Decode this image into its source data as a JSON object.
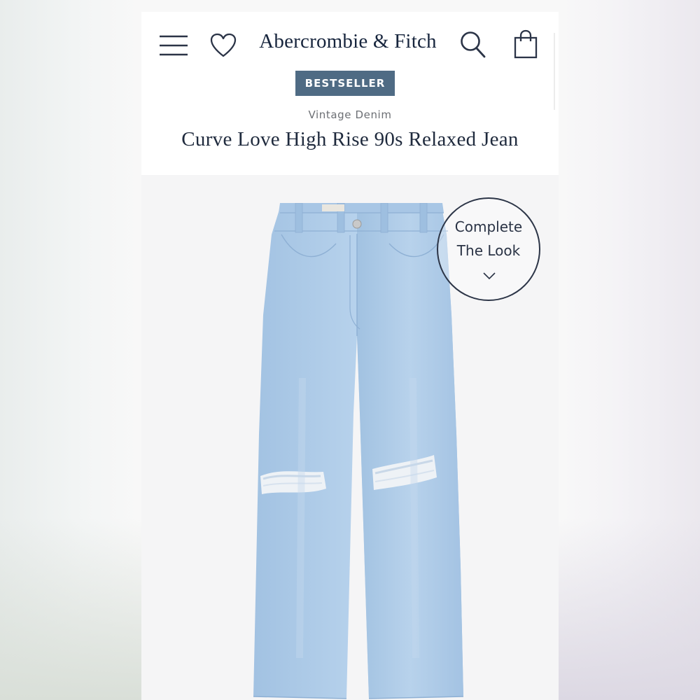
{
  "header": {
    "brand": "Abercrombie & Fitch",
    "icons": [
      "menu-icon",
      "heart-icon",
      "search-icon",
      "shopping-bag-icon"
    ]
  },
  "product": {
    "badge": "BESTSELLER",
    "category": "Vintage Denim",
    "title": "Curve Love High Rise 90s Relaxed Jean"
  },
  "complete_look": {
    "line1": "Complete",
    "line2": "The Look",
    "icon": "chevron-down-icon"
  },
  "colors": {
    "brand_text": "#17253d",
    "badge_bg": "#4f6b84",
    "denim": "#a9c8e6"
  }
}
